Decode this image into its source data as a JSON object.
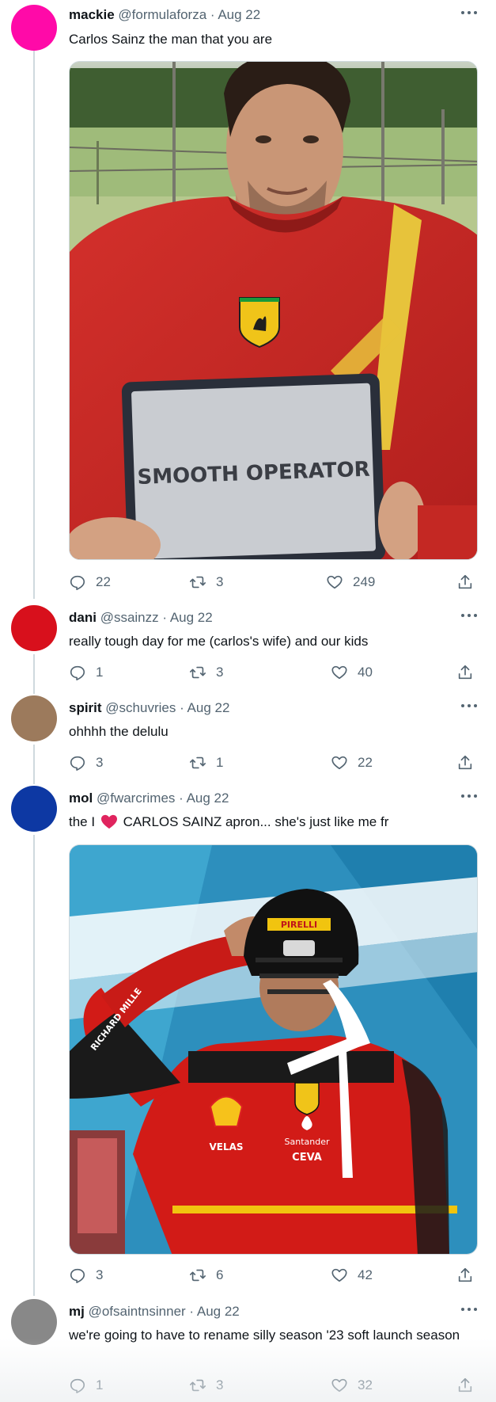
{
  "tweets": [
    {
      "display_name": "mackie",
      "handle": "@formulaforza",
      "date": "Aug 22",
      "text": "Carlos Sainz the man that you are",
      "avatar_color": "#ff0aa8",
      "media": {
        "sign_text": "SMOOTH OPERATOR"
      },
      "stats": {
        "replies": "22",
        "retweets": "3",
        "likes": "249"
      }
    },
    {
      "display_name": "dani",
      "handle": "@ssainzz",
      "date": "Aug 22",
      "text": "really tough day for me (carlos's wife) and our kids",
      "avatar_color": "#d8101c",
      "stats": {
        "replies": "1",
        "retweets": "3",
        "likes": "40"
      }
    },
    {
      "display_name": "spirit",
      "handle": "@schuvries",
      "date": "Aug 22",
      "text": "ohhhh the delulu",
      "avatar_color": "#9c7a5c",
      "stats": {
        "replies": "3",
        "retweets": "1",
        "likes": "22"
      }
    },
    {
      "display_name": "mol",
      "handle": "@fwarcrimes",
      "date": "Aug 22",
      "text_before_heart": "the I",
      "text_after_heart": "CARLOS SAINZ apron... she's just like me fr",
      "avatar_color": "#0d38a3",
      "media": {
        "helmet_brand": "PIRELLI",
        "sleeve_text": "RICHARD MILLE",
        "sponsor_1": "VELAS",
        "sponsor_2": "Santander",
        "sponsor_3": "CEVA"
      },
      "stats": {
        "replies": "3",
        "retweets": "6",
        "likes": "42"
      }
    },
    {
      "display_name": "mj",
      "handle": "@ofsaintnsinner",
      "date": "Aug 22",
      "text": "we're going to have to rename silly season '23 soft launch season",
      "avatar_color": "#888888",
      "stats": {
        "replies": "1",
        "retweets": "3",
        "likes": "32"
      }
    }
  ],
  "separator": " · ",
  "icons": [
    "reply-icon",
    "retweet-icon",
    "like-icon",
    "share-icon",
    "more-icon",
    "heart-emoji"
  ],
  "colors": {
    "text": "#0f1419",
    "secondary": "#536471",
    "thread_line": "#cfd9de",
    "heart": "#e0245e"
  }
}
